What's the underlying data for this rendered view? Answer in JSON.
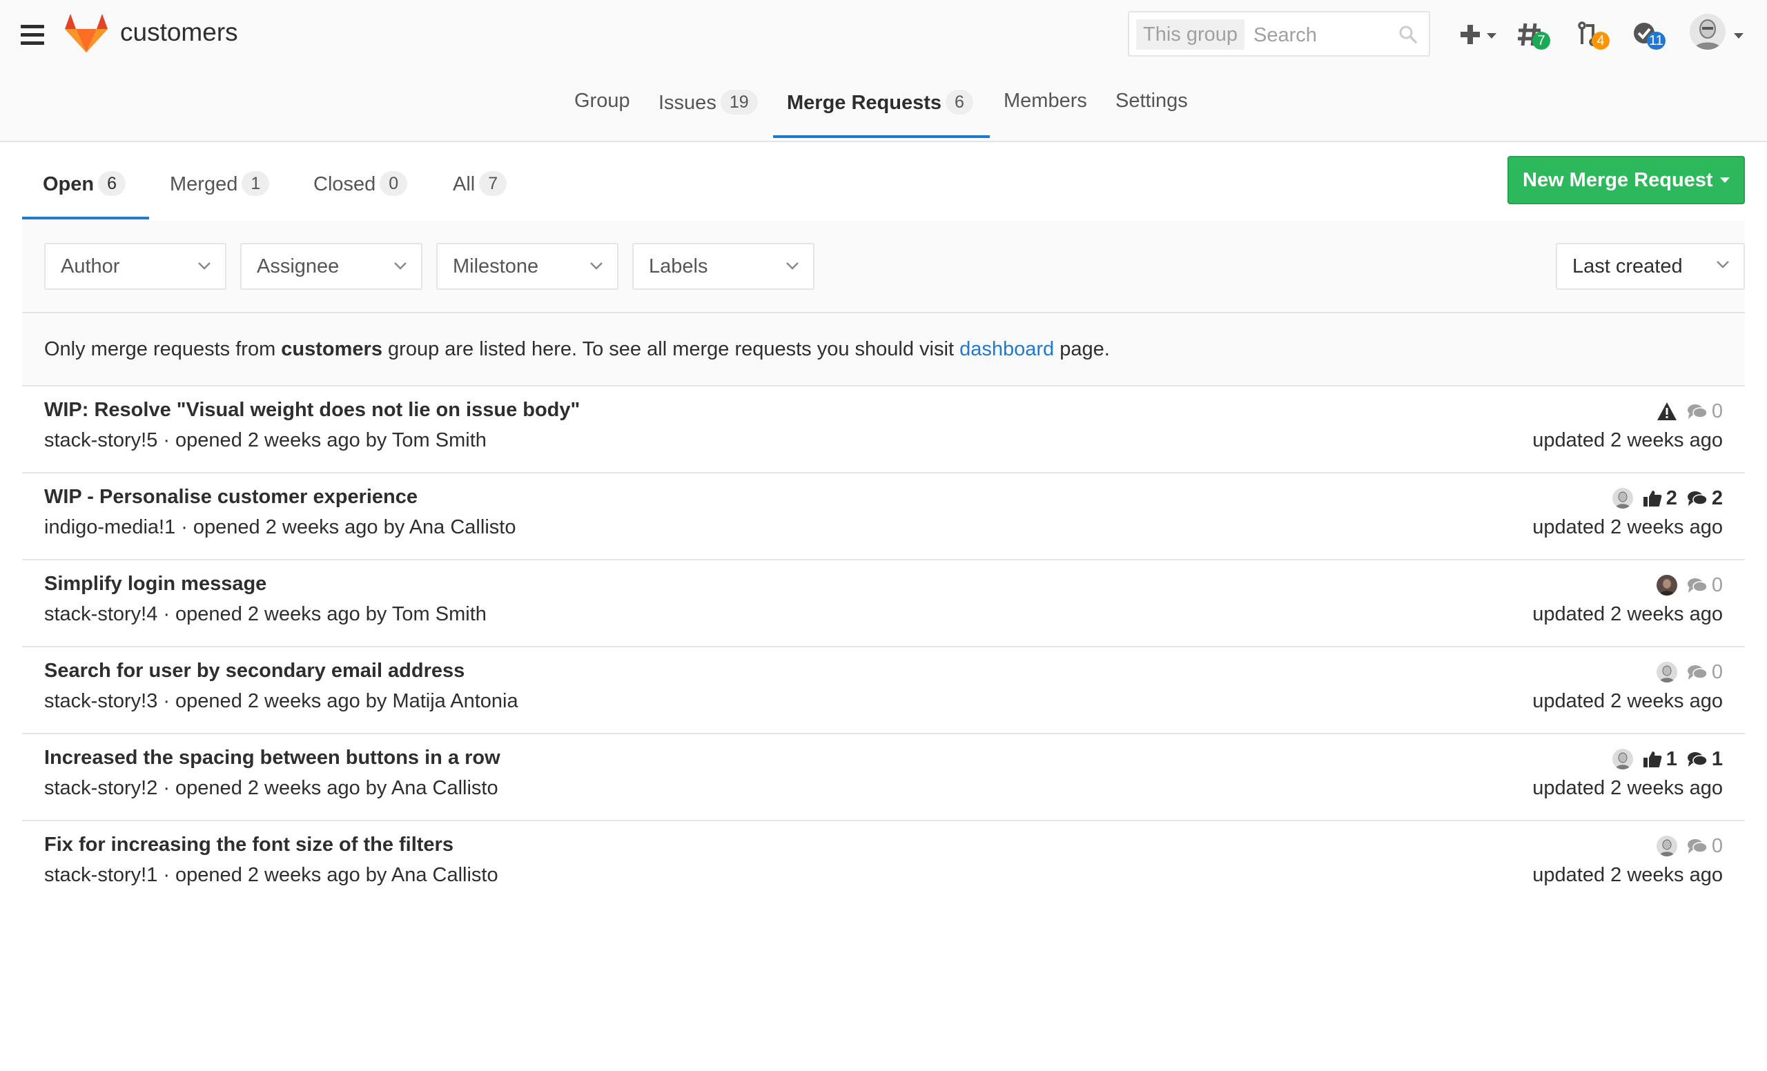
{
  "header": {
    "group_name": "customers",
    "search": {
      "scope": "This group",
      "placeholder": "Search"
    },
    "issues_count": "7",
    "mr_count": "4",
    "todos_count": "11",
    "colors": {
      "issues_badge": "#1aaa55",
      "mr_badge": "#fc9403",
      "todos_badge": "#1f78d1"
    }
  },
  "nav": {
    "group": "Group",
    "issues": "Issues",
    "issues_count": "19",
    "merge_requests": "Merge Requests",
    "merge_requests_count": "6",
    "members": "Members",
    "settings": "Settings"
  },
  "tabs": {
    "open": "Open",
    "open_count": "6",
    "merged": "Merged",
    "merged_count": "1",
    "closed": "Closed",
    "closed_count": "0",
    "all": "All",
    "all_count": "7"
  },
  "new_mr_button": "New Merge Request",
  "filters": {
    "author": "Author",
    "assignee": "Assignee",
    "milestone": "Milestone",
    "labels": "Labels",
    "sort": "Last created"
  },
  "notice": {
    "prefix": "Only merge requests from",
    "group": "customers",
    "middle": "group are listed here. To see all merge requests you should visit",
    "link": "dashboard",
    "suffix": "page."
  },
  "merge_requests": [
    {
      "title": "WIP: Resolve \"Visual weight does not lie on issue body\"",
      "ref": "stack-story!5",
      "opened": "opened 2 weeks ago by Tom Smith",
      "updated": "updated 2 weeks ago",
      "warning": true,
      "avatar": false,
      "upvotes": "",
      "comments": "0"
    },
    {
      "title": "WIP - Personalise customer experience",
      "ref": "indigo-media!1",
      "opened": "opened 2 weeks ago by Ana Callisto",
      "updated": "updated 2 weeks ago",
      "warning": false,
      "avatar": true,
      "upvotes": "2",
      "comments": "2"
    },
    {
      "title": "Simplify login message",
      "ref": "stack-story!4",
      "opened": "opened 2 weeks ago by Tom Smith",
      "updated": "updated 2 weeks ago",
      "warning": false,
      "avatar": true,
      "avatar_dark": true,
      "upvotes": "",
      "comments": "0"
    },
    {
      "title": "Search for user by secondary email address",
      "ref": "stack-story!3",
      "opened": "opened 2 weeks ago by Matija Antonia",
      "updated": "updated 2 weeks ago",
      "warning": false,
      "avatar": true,
      "upvotes": "",
      "comments": "0"
    },
    {
      "title": "Increased the spacing between buttons in a row",
      "ref": "stack-story!2",
      "opened": "opened 2 weeks ago by Ana Callisto",
      "updated": "updated 2 weeks ago",
      "warning": false,
      "avatar": true,
      "upvotes": "1",
      "comments": "1"
    },
    {
      "title": "Fix for increasing the font size of the filters",
      "ref": "stack-story!1",
      "opened": "opened 2 weeks ago by Ana Callisto",
      "updated": "updated 2 weeks ago",
      "warning": false,
      "avatar": true,
      "upvotes": "",
      "comments": "0"
    }
  ]
}
